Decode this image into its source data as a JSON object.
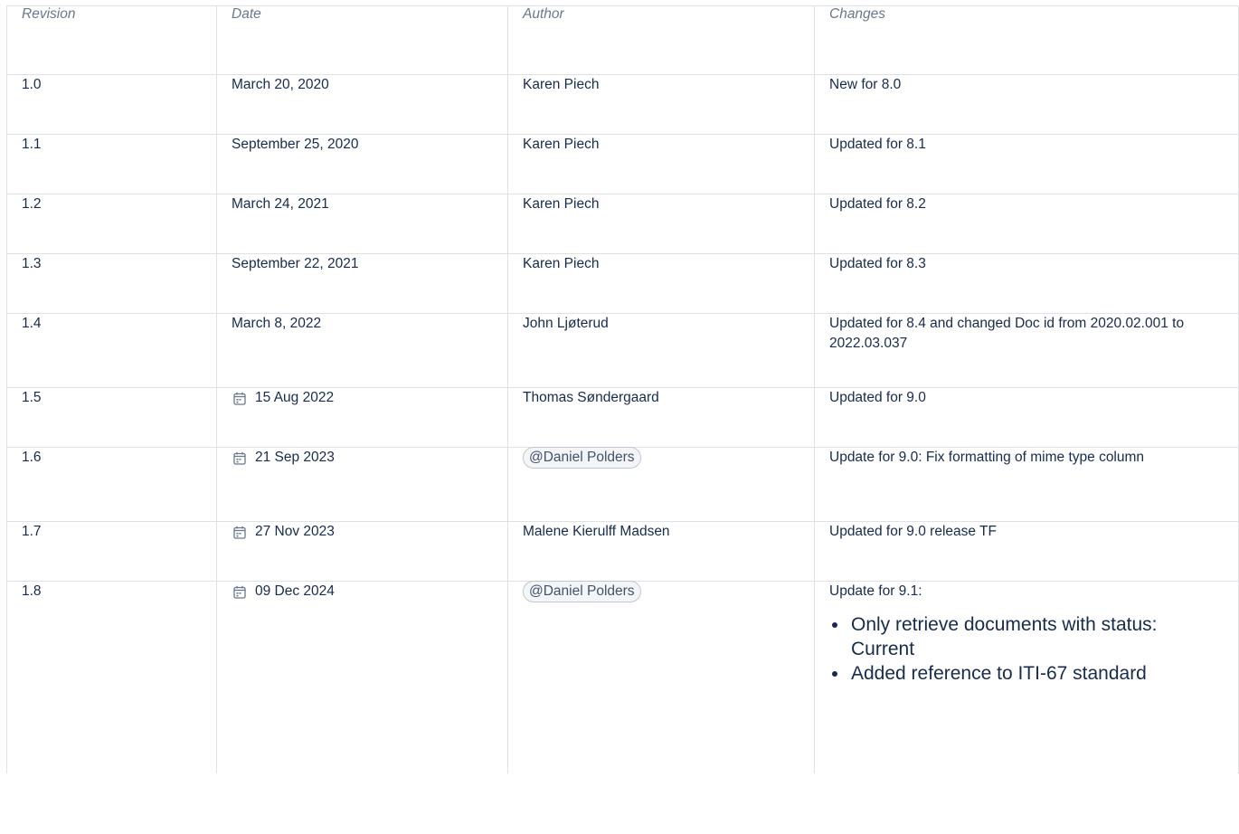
{
  "headers": {
    "revision": "Revision",
    "date": "Date",
    "author": "Author",
    "changes": "Changes"
  },
  "rows": [
    {
      "revision": "1.0",
      "date": "March 20, 2020",
      "author": "Karen Piech",
      "changes": "New for 8.0"
    },
    {
      "revision": "1.1",
      "date": "September 25, 2020",
      "author": "Karen Piech",
      "changes": "Updated for 8.1"
    },
    {
      "revision": "1.2",
      "date": "March 24, 2021",
      "author": "Karen Piech",
      "changes": "Updated for 8.2"
    },
    {
      "revision": "1.3",
      "date": "September 22, 2021",
      "author": "Karen Piech",
      "changes": "Updated for 8.3"
    },
    {
      "revision": "1.4",
      "date": "March 8, 2022",
      "author": "John Ljøterud",
      "changes": "Updated for 8.4 and changed Doc id from 2020.02.001 to 2022.03.037"
    },
    {
      "revision": "1.5",
      "date": "15 Aug 2022",
      "author": "Thomas Søndergaard",
      "changes": "Updated for 9.0"
    },
    {
      "revision": "1.6",
      "date": "21 Sep 2023",
      "author": "@Daniel Polders",
      "changes": "Update for 9.0: Fix formatting of mime type column"
    },
    {
      "revision": "1.7",
      "date": "27 Nov 2023",
      "author": "Malene Kierulff Madsen",
      "changes": "Updated for 9.0 release TF"
    },
    {
      "revision": "1.8",
      "date": "09 Dec 2024",
      "author": "@Daniel Polders",
      "changes": "Update for 9.1:",
      "change_items": [
        "Only retrieve documents with status: Current",
        "Added reference to ITI-67 standard"
      ]
    }
  ],
  "icons": {
    "date": "calendar-icon"
  },
  "colors": {
    "header_text": "#6b778c",
    "body_text": "#172b4d",
    "border": "#dfe1e6",
    "mention_bg": "#f4f5f7",
    "mention_text": "#42526e"
  }
}
